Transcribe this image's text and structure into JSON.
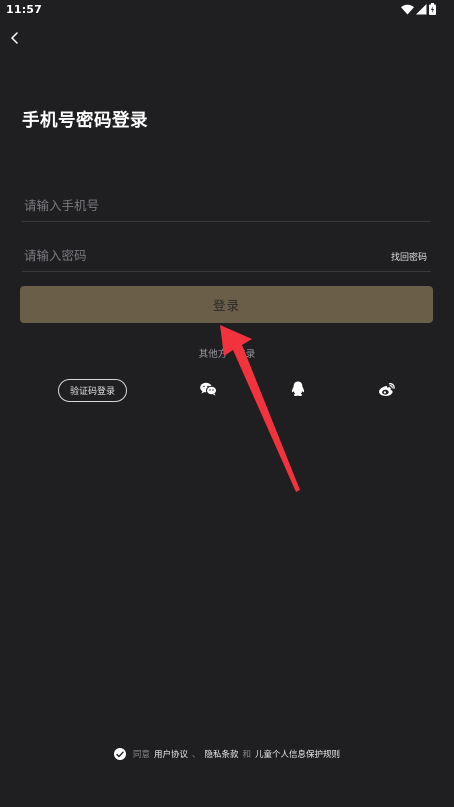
{
  "status_bar": {
    "time": "11:57"
  },
  "page": {
    "title": "手机号密码登录"
  },
  "form": {
    "phone_placeholder": "请输入手机号",
    "password_placeholder": "请输入密码",
    "forgot_password": "找回密码",
    "login_button": "登录"
  },
  "other_login": {
    "label_prefix": "其他方",
    "label_suffix": "登录",
    "sms_button": "验证码登录",
    "providers": [
      "wechat-icon",
      "qq-icon",
      "weibo-icon"
    ]
  },
  "agreement": {
    "agree_prefix": "同意",
    "user_agreement": "用户协议",
    "separator": "、",
    "privacy_terms": "隐私条款",
    "and": "和",
    "children_privacy": "儿童个人信息保护规则"
  },
  "colors": {
    "background": "#1f1f22",
    "login_button": "#6a5e49",
    "annotation_arrow": "#f2333d"
  }
}
